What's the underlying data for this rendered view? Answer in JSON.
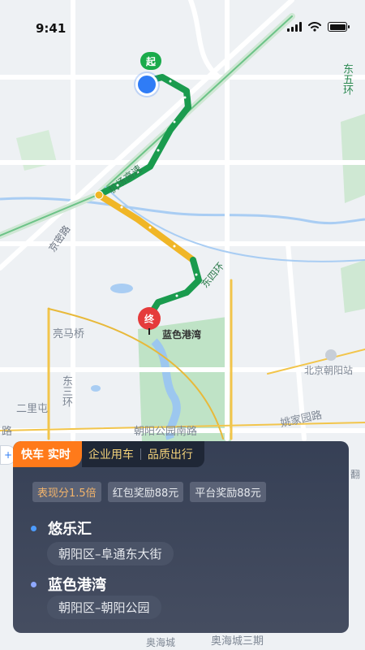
{
  "status": {
    "time": "9:41"
  },
  "map": {
    "labels": {
      "road_top_right": "东五环",
      "road_airport": "机场高速",
      "road_jingmi": "京密路",
      "road_dongsihuan": "东四环",
      "area_liangmaqiao": "亮马桥",
      "area_ershi": "二里屯",
      "road_dongsan": "东三环",
      "road_chaoyang_gongyuan_nan": "朝阳公园南路",
      "road_yaojia": "姚家园路",
      "road_lu": "路",
      "poi_beijing_chaoyang_station": "北京朝阳站",
      "road_aohai": "奥海城",
      "road_aohai_3": "奥海城三期",
      "road_fan": "翻"
    },
    "start_pin": "起",
    "end_pin": "终",
    "end_label": "蓝色港湾",
    "route_colors": {
      "green": "#1a9b4e",
      "yellow": "#f0b627"
    }
  },
  "panel": {
    "tabs": {
      "active": "快车 实时",
      "enterprise": "企业用车",
      "premium": "品质出行"
    },
    "chips": [
      "表现分1.5倍",
      "红包奖励88元",
      "平台奖励88元"
    ],
    "origin": {
      "name": "悠乐汇",
      "detail": "朝阳区–阜通东大街",
      "dot_color": "#4d9cff"
    },
    "destination": {
      "name": "蓝色港湾",
      "detail": "朝阳区–朝阳公园",
      "dot_color": "#8fa8ff"
    }
  }
}
